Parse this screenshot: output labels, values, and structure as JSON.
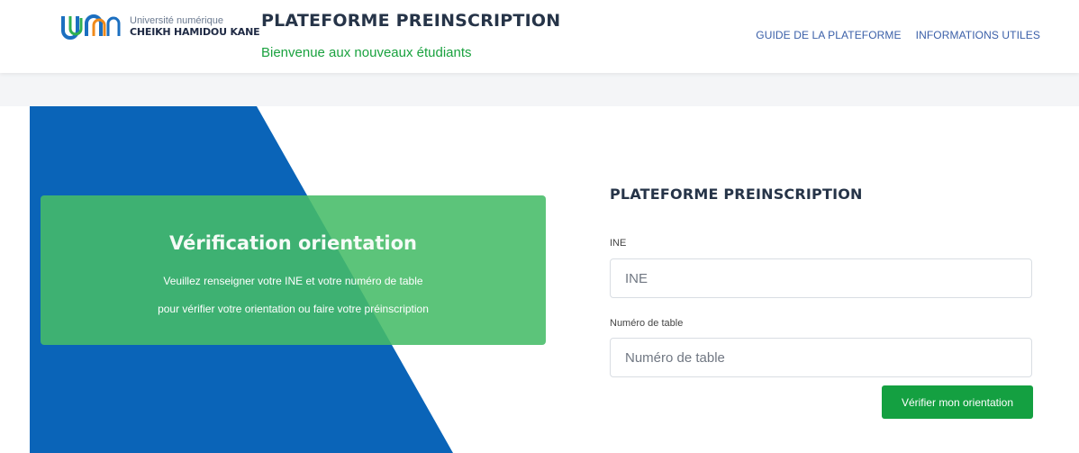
{
  "header": {
    "logo": {
      "line1": "Université numérique",
      "line2": "CHEIKH HAMIDOU KANE"
    },
    "title": "PLATEFORME PREINSCRIPTION",
    "subtitle": "Bienvenue aux nouveaux étudiants",
    "nav": [
      {
        "label": "GUIDE DE LA PLATEFORME"
      },
      {
        "label": "INFORMATIONS UTILES"
      }
    ]
  },
  "hero": {
    "heading": "Vérification orientation",
    "line1": "Veuillez renseigner votre INE et votre numéro de table",
    "line2": "pour vérifier votre orientation ou faire votre préinscription"
  },
  "form": {
    "title": "PLATEFORME PREINSCRIPTION",
    "ine_label": "INE",
    "ine_placeholder": "INE",
    "ine_value": "",
    "table_label": "Numéro de table",
    "table_placeholder": "Numéro de table",
    "table_value": "",
    "submit_label": "Vérifier mon orientation"
  },
  "colors": {
    "brand_blue": "#0a64b8",
    "brand_green": "#14a041",
    "card_green": "#46bc68",
    "nav_link": "#3a5fa8"
  }
}
